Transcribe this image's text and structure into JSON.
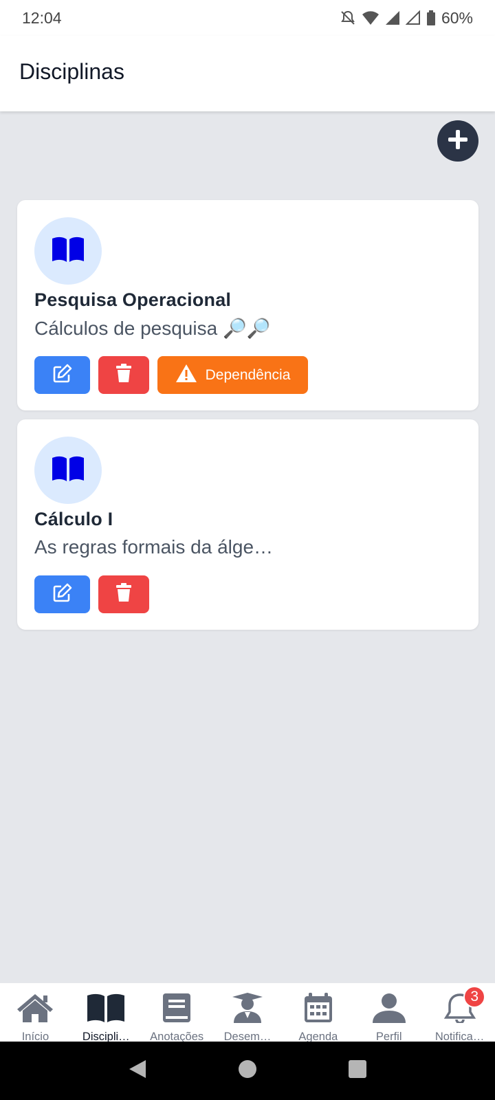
{
  "status_bar": {
    "time": "12:04",
    "battery": "60%"
  },
  "header": {
    "title": "Disciplinas"
  },
  "add_button": {
    "icon": "plus-circle-icon"
  },
  "cards": [
    {
      "title": "Pesquisa Operacional",
      "description": "Cálculos de pesquisa 🔎🔎",
      "icon": "book-open-icon",
      "dependency_label": "Dependência"
    },
    {
      "title": "Cálculo I",
      "description": "As regras formais da álge…",
      "icon": "book-open-icon"
    }
  ],
  "nav": [
    {
      "label": "Início",
      "icon": "home-icon"
    },
    {
      "label": "Discipli…",
      "icon": "book-open-icon"
    },
    {
      "label": "Anotações",
      "icon": "book-icon"
    },
    {
      "label": "Desem…",
      "icon": "graduate-icon"
    },
    {
      "label": "Agenda",
      "icon": "calendar-icon"
    },
    {
      "label": "Perfil",
      "icon": "user-icon"
    },
    {
      "label": "Notifica…",
      "icon": "bell-icon",
      "badge": "3"
    }
  ],
  "colors": {
    "primary_dark": "#2b3446",
    "edit": "#3b82f6",
    "delete": "#ef4444",
    "dependency": "#f97316",
    "book_icon": "#0000e6",
    "avatar_bg": "#dbeafe"
  }
}
